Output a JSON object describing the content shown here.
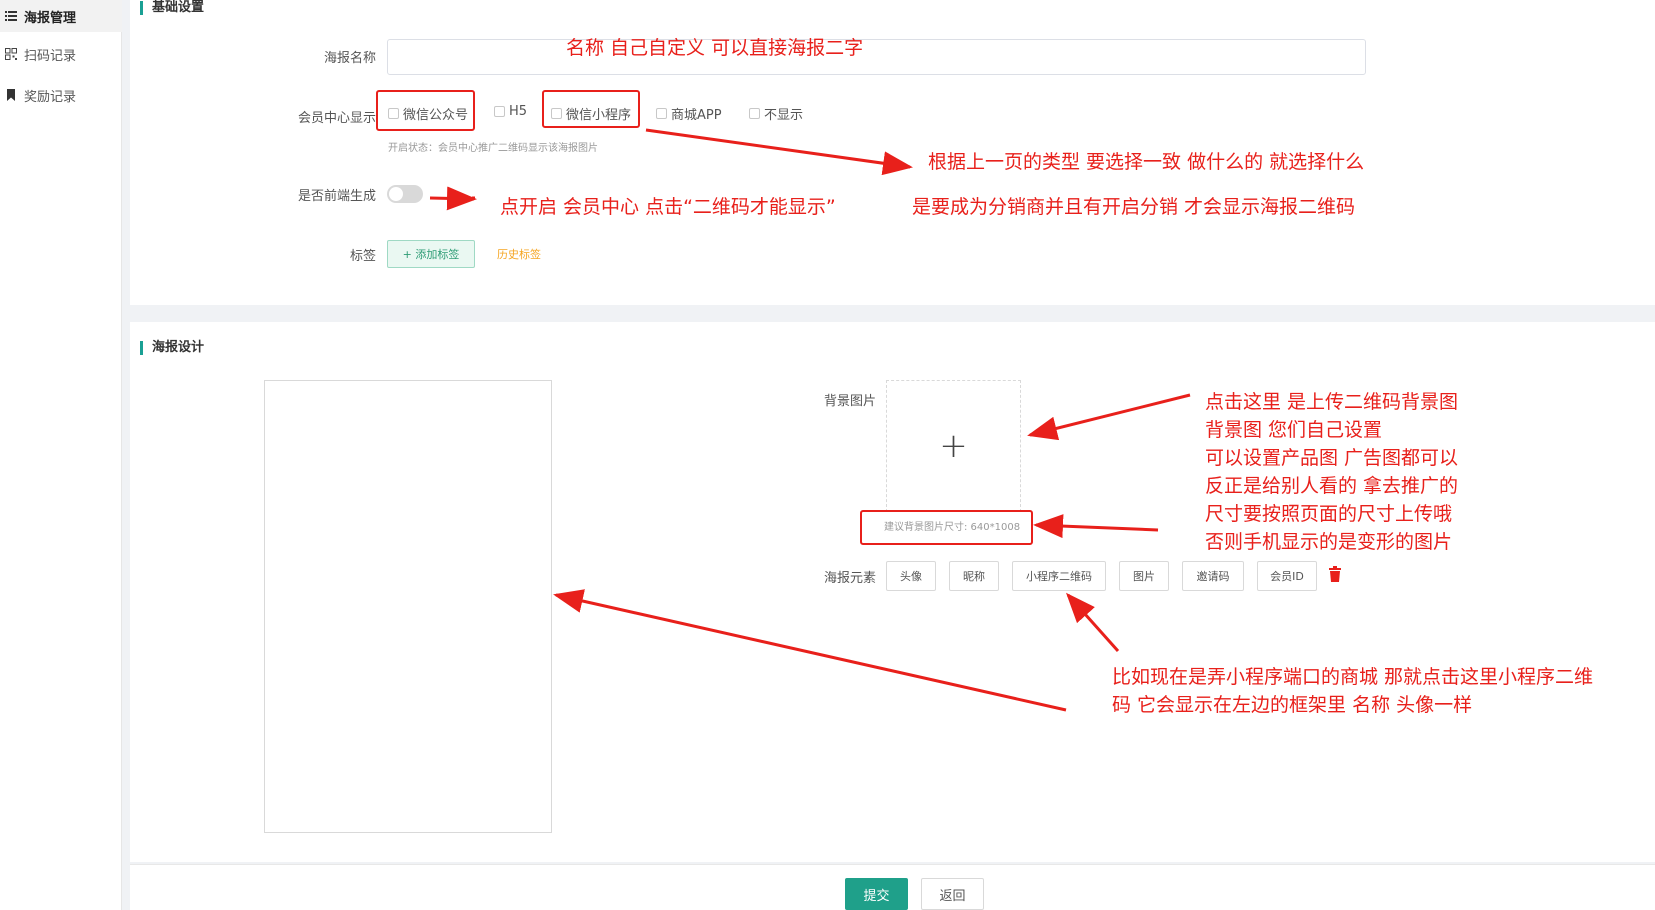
{
  "sidebar": {
    "items": [
      {
        "label": "海报管理",
        "icon": "list-icon"
      },
      {
        "label": "扫码记录",
        "icon": "qrcode-icon"
      },
      {
        "label": "奖励记录",
        "icon": "bookmark-icon"
      }
    ]
  },
  "basic": {
    "section_title": "基础设置",
    "name_label": "海报名称",
    "name_value": "",
    "display_label": "会员中心显示",
    "display_options": [
      "微信公众号",
      "H5",
      "微信小程序",
      "商城APP",
      "不显示"
    ],
    "display_hint": "开启状态：会员中心推广二维码显示该海报图片",
    "frontend_label": "是否前端生成",
    "tag_label": "标签",
    "tag_add": "+ 添加标签",
    "tag_history": "历史标签"
  },
  "design": {
    "section_title": "海报设计",
    "bg_label": "背景图片",
    "bg_size_hint": "建议背景图片尺寸: 640*1008",
    "elements_label": "海报元素",
    "elements": [
      "头像",
      "昵称",
      "小程序二维码",
      "图片",
      "邀请码",
      "会员ID"
    ]
  },
  "footer": {
    "submit": "提交",
    "back": "返回"
  },
  "annotations": {
    "name_note": "名称 自己自定义 可以直接海报二字",
    "type_note": "根据上一页的类型 要选择一致 做什么的 就选择什么",
    "switch_note": "点开启  会员中心 点击“二维码才能显示”",
    "distributor_note": "是要成为分销商并且有开启分销 才会显示海报二维码",
    "bg_note_lines": [
      "点击这里 是上传二维码背景图",
      "背景图 您们自己设置",
      "可以设置产品图 广告图都可以",
      "反正是给别人看的 拿去推广的",
      "尺寸要按照页面的尺寸上传哦",
      "否则手机显示的是变形的图片"
    ],
    "element_note_lines": [
      "比如现在是弄小程序端口的商城 那就点击这里小程序二维",
      "码 它会显示在左边的框架里 名称 头像一样"
    ],
    "color": "#e8201b"
  },
  "colors": {
    "accent": "#1aa094",
    "submit": "#1fa08a",
    "history_link": "#f5a623"
  }
}
